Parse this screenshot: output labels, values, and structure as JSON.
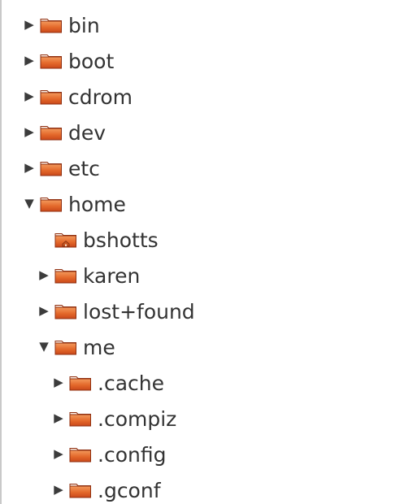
{
  "tree": {
    "items": [
      {
        "label": "bin",
        "level": 0,
        "expanded": false,
        "icon": "folder-icon",
        "has_children": true
      },
      {
        "label": "boot",
        "level": 0,
        "expanded": false,
        "icon": "folder-icon",
        "has_children": true
      },
      {
        "label": "cdrom",
        "level": 0,
        "expanded": false,
        "icon": "folder-icon",
        "has_children": true
      },
      {
        "label": "dev",
        "level": 0,
        "expanded": false,
        "icon": "folder-icon",
        "has_children": true
      },
      {
        "label": "etc",
        "level": 0,
        "expanded": false,
        "icon": "folder-icon",
        "has_children": true
      },
      {
        "label": "home",
        "level": 0,
        "expanded": true,
        "icon": "folder-icon",
        "has_children": true
      },
      {
        "label": "bshotts",
        "level": 1,
        "expanded": false,
        "icon": "home-folder-icon",
        "has_children": false
      },
      {
        "label": "karen",
        "level": 1,
        "expanded": false,
        "icon": "folder-icon",
        "has_children": true
      },
      {
        "label": "lost+found",
        "level": 1,
        "expanded": false,
        "icon": "folder-icon",
        "has_children": true
      },
      {
        "label": "me",
        "level": 1,
        "expanded": true,
        "icon": "folder-icon",
        "has_children": true
      },
      {
        "label": ".cache",
        "level": 2,
        "expanded": false,
        "icon": "folder-icon",
        "has_children": true
      },
      {
        "label": ".compiz",
        "level": 2,
        "expanded": false,
        "icon": "folder-icon",
        "has_children": true
      },
      {
        "label": ".config",
        "level": 2,
        "expanded": false,
        "icon": "folder-icon",
        "has_children": true
      },
      {
        "label": ".gconf",
        "level": 2,
        "expanded": false,
        "icon": "folder-icon",
        "has_children": true
      }
    ]
  },
  "colors": {
    "folder_top": "#f39a5d",
    "folder_mid": "#e4682a",
    "folder_bottom": "#c9481a",
    "folder_edge": "#8f2f10",
    "home_badge": "#c7541f",
    "text": "#333333"
  }
}
